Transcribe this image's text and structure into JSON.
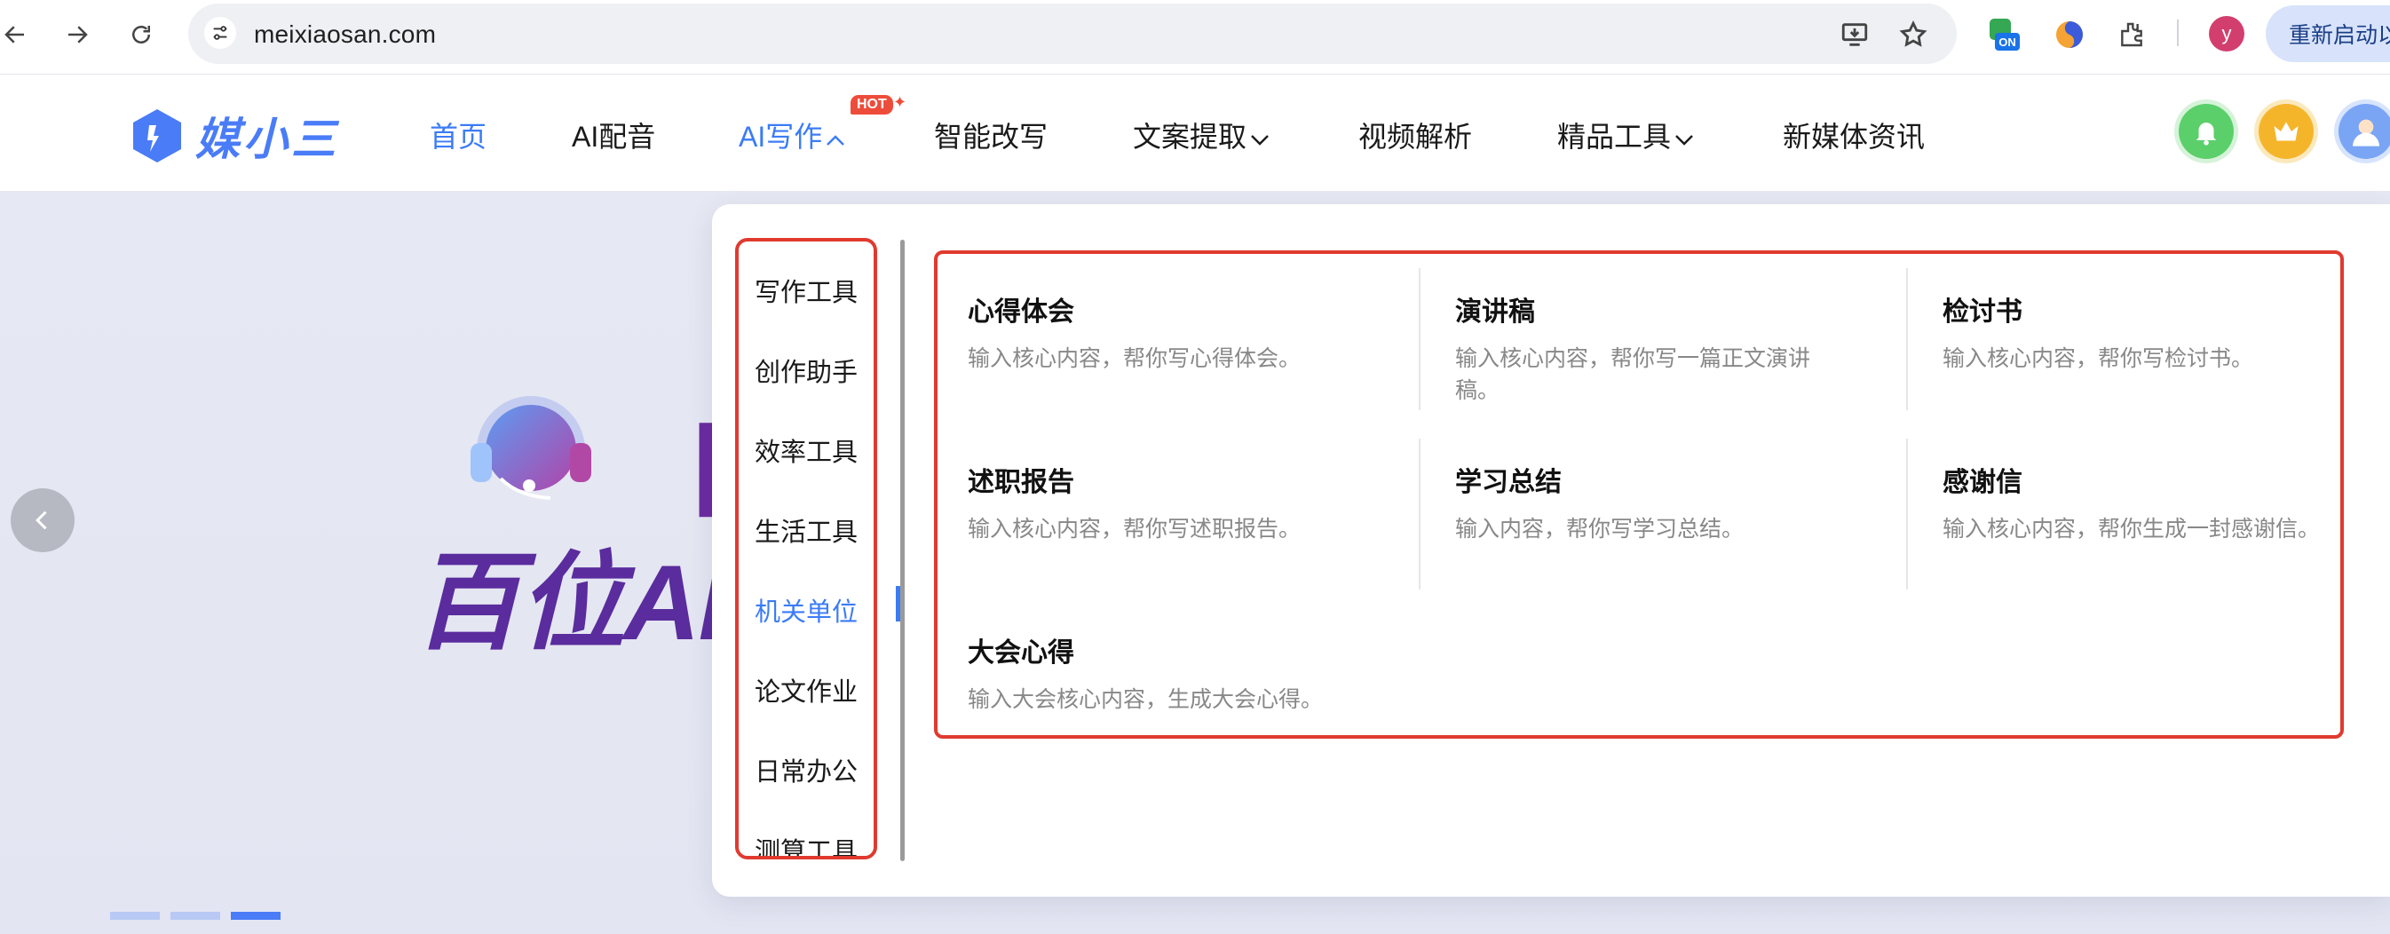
{
  "browser": {
    "url": "meixiaosan.com",
    "profile_initial": "y",
    "relaunch_label": "重新启动以",
    "ext_badge": "ON"
  },
  "site": {
    "logo_text": "媒小三",
    "nav": [
      {
        "label": "首页",
        "active": true
      },
      {
        "label": "AI配音"
      },
      {
        "label": "AI写作",
        "badge": "HOT",
        "chevron": "up"
      },
      {
        "label": "智能改写"
      },
      {
        "label": "文案提取",
        "chevron": "down"
      },
      {
        "label": "视频解析"
      },
      {
        "label": "精品工具",
        "chevron": "down"
      },
      {
        "label": "新媒体资讯"
      }
    ],
    "icons": [
      "bell-icon",
      "crown-icon",
      "avatar"
    ]
  },
  "hero": {
    "bracket_text": "【媒",
    "slogan": "百位AI配"
  },
  "dropdown": {
    "categories": [
      "写作工具",
      "创作助手",
      "效率工具",
      "生活工具",
      "机关单位",
      "论文作业",
      "日常办公",
      "测算工具"
    ],
    "active_category": "机关单位",
    "items": [
      {
        "title": "心得体会",
        "desc": "输入核心内容，帮你写心得体会。"
      },
      {
        "title": "演讲稿",
        "desc": "输入核心内容，帮你写一篇正文演讲稿。"
      },
      {
        "title": "检讨书",
        "desc": "输入核心内容，帮你写检讨书。"
      },
      {
        "title": "述职报告",
        "desc": "输入核心内容，帮你写述职报告。"
      },
      {
        "title": "学习总结",
        "desc": "输入内容，帮你写学习总结。"
      },
      {
        "title": "感谢信",
        "desc": "输入核心内容，帮你生成一封感谢信。"
      },
      {
        "title": "大会心得",
        "desc": "输入大会核心内容，生成大会心得。"
      }
    ]
  },
  "colors": {
    "accent": "#3b7cf6",
    "highlight_border": "#e03a2f",
    "hot_badge": "#ee4c3a"
  }
}
